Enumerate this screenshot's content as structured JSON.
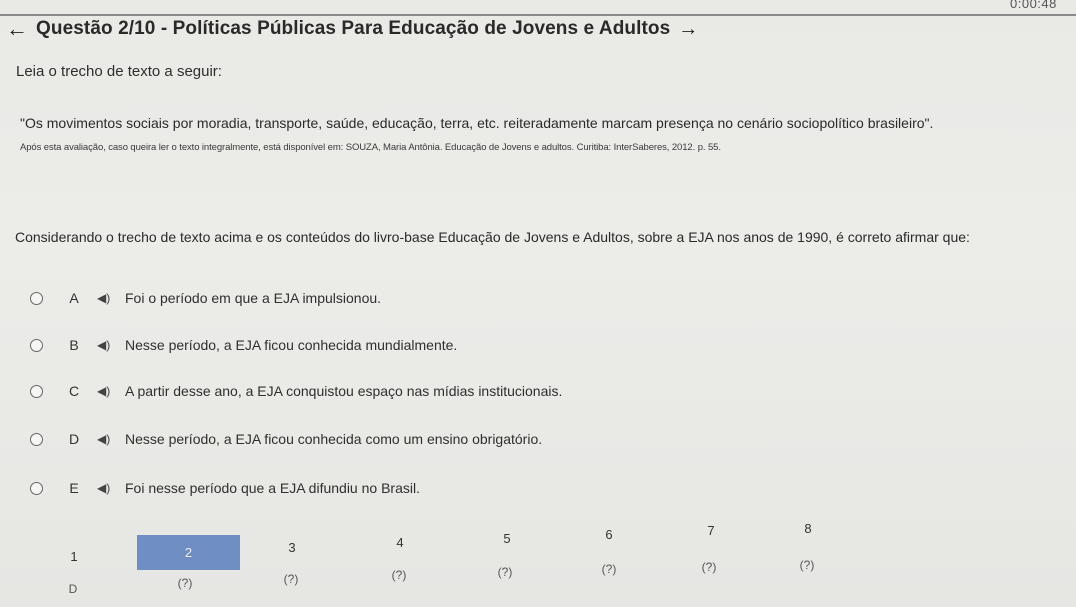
{
  "timer": "0:00:48",
  "header": {
    "back_icon": "arrow-left-icon",
    "title": "Questão 2/10 - Políticas Públicas Para Educação de Jovens e Adultos",
    "next_icon": "arrow-right-icon"
  },
  "intro": "Leia o trecho de texto a seguir:",
  "quote": "\"Os movimentos sociais por moradia, transporte, saúde, educação, terra, etc. reiteradamente marcam presença no cenário sociopolítico brasileiro\".",
  "source": "Após esta avaliação, caso queira ler o texto integralmente, está disponível em: SOUZA, Maria Antônia. Educação de Jovens e adultos. Curitiba: InterSaberes, 2012. p. 55.",
  "question": "Considerando o trecho de texto acima e os conteúdos do livro-base Educação de Jovens e Adultos, sobre a EJA nos anos de 1990, é correto afirmar que:",
  "options": [
    {
      "letter": "A",
      "text": "Foi o período em que a EJA impulsionou."
    },
    {
      "letter": "B",
      "text": "Nesse período, a EJA ficou conhecida mundialmente."
    },
    {
      "letter": "C",
      "text": "A partir desse ano, a EJA conquistou espaço nas mídias institucionais."
    },
    {
      "letter": "D",
      "text": "Nesse período, a EJA ficou conhecida como um ensino obrigatório."
    },
    {
      "letter": "E",
      "text": "Foi nesse período que a EJA difundiu no Brasil."
    }
  ],
  "question_nav": {
    "numbers": [
      "1",
      "2",
      "3",
      "4",
      "5",
      "6",
      "7",
      "8"
    ],
    "active": "2",
    "statuses": [
      "D",
      "(?)",
      "(?)",
      "(?)",
      "(?)",
      "(?)",
      "(?)",
      "(?)"
    ]
  }
}
